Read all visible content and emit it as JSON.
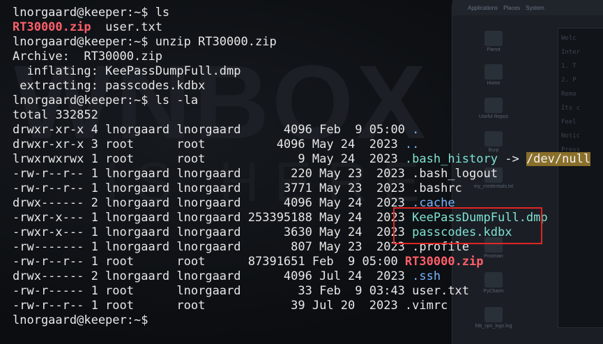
{
  "lines": [
    {
      "segs": [
        {
          "t": "lnorgaard@keeper:~$ ls",
          "c": ""
        }
      ]
    },
    {
      "segs": [
        {
          "t": "RT30000.zip",
          "c": "red"
        },
        {
          "t": "  user.txt",
          "c": ""
        }
      ]
    },
    {
      "segs": [
        {
          "t": "lnorgaard@keeper:~$ unzip RT30000.zip",
          "c": ""
        }
      ]
    },
    {
      "segs": [
        {
          "t": "Archive:  RT30000.zip",
          "c": ""
        }
      ]
    },
    {
      "segs": [
        {
          "t": "  inflating: KeePassDumpFull.dmp",
          "c": ""
        }
      ]
    },
    {
      "segs": [
        {
          "t": " extracting: passcodes.kdbx",
          "c": ""
        }
      ]
    },
    {
      "segs": [
        {
          "t": "lnorgaard@keeper:~$ ls -la",
          "c": ""
        }
      ]
    },
    {
      "segs": [
        {
          "t": "total 332852",
          "c": ""
        }
      ]
    },
    {
      "segs": [
        {
          "t": "drwxr-xr-x 4 lnorgaard lnorgaard      4096 Feb  9 05:00 ",
          "c": ""
        },
        {
          "t": ".",
          "c": "blue"
        }
      ]
    },
    {
      "segs": [
        {
          "t": "drwxr-xr-x 3 root      root          4096 May 24  2023 ",
          "c": ""
        },
        {
          "t": "..",
          "c": "blue"
        }
      ]
    },
    {
      "segs": [
        {
          "t": "lrwxrwxrwx 1 root      root             9 May 24  2023 ",
          "c": ""
        },
        {
          "t": ".bash_history",
          "c": "cyan"
        },
        {
          "t": " -> ",
          "c": ""
        },
        {
          "t": "/dev/null",
          "c": "hl"
        }
      ]
    },
    {
      "segs": [
        {
          "t": "-rw-r--r-- 1 lnorgaard lnorgaard       220 May 23  2023 .bash_logout",
          "c": ""
        }
      ]
    },
    {
      "segs": [
        {
          "t": "-rw-r--r-- 1 lnorgaard lnorgaard      3771 May 23  2023 .bashrc",
          "c": ""
        }
      ]
    },
    {
      "segs": [
        {
          "t": "drwx------ 2 lnorgaard lnorgaard      4096 May 24  2023 ",
          "c": ""
        },
        {
          "t": ".cache",
          "c": "blue"
        }
      ]
    },
    {
      "segs": [
        {
          "t": "-rwxr-x--- 1 lnorgaard lnorgaard 253395188 May 24  2023 ",
          "c": ""
        },
        {
          "t": "KeePassDumpFull.dmp",
          "c": "cyan"
        }
      ]
    },
    {
      "segs": [
        {
          "t": "-rwxr-x--- 1 lnorgaard lnorgaard      3630 May 24  2023 ",
          "c": ""
        },
        {
          "t": "passcodes.kdbx",
          "c": "cyan"
        }
      ]
    },
    {
      "segs": [
        {
          "t": "-rw------- 1 lnorgaard lnorgaard       807 May 23  2023 .profile",
          "c": ""
        }
      ]
    },
    {
      "segs": [
        {
          "t": "-rw-r--r-- 1 root      root      87391651 Feb  9 05:00 ",
          "c": ""
        },
        {
          "t": "RT30000.zip",
          "c": "red"
        }
      ]
    },
    {
      "segs": [
        {
          "t": "drwx------ 2 lnorgaard lnorgaard      4096 Jul 24  2023 ",
          "c": ""
        },
        {
          "t": ".ssh",
          "c": "blue"
        }
      ]
    },
    {
      "segs": [
        {
          "t": "-rw-r----- 1 root      lnorgaard        33 Feb  9 03:43 user.txt",
          "c": ""
        }
      ]
    },
    {
      "segs": [
        {
          "t": "-rw-r--r-- 1 root      root            39 Jul 20  2023 .vimrc",
          "c": ""
        }
      ]
    },
    {
      "segs": [
        {
          "t": "lnorgaard@keeper:~$",
          "c": ""
        }
      ]
    }
  ],
  "watermark": {
    "line1": "WNBOX",
    "line2": "IS HERE"
  },
  "desktop": {
    "menu": [
      "Applications",
      "Places",
      "System"
    ],
    "icons": [
      "Parrot",
      "Home",
      "Useful Repos",
      "Burp",
      "my_credentials.txt",
      "Postman",
      "PyCharm",
      "htb_vpn_logs.log"
    ],
    "side_terminal_lines": [
      "Welc",
      "Inter",
      "1. T",
      "2. P",
      "Remo",
      "Its c",
      "Feel",
      "Notic",
      "Press"
    ]
  },
  "colors": {
    "red": "#ff5f6a",
    "blue": "#78b4ff",
    "cyan": "#7fe3d3",
    "highlight_box": "#e02626"
  }
}
